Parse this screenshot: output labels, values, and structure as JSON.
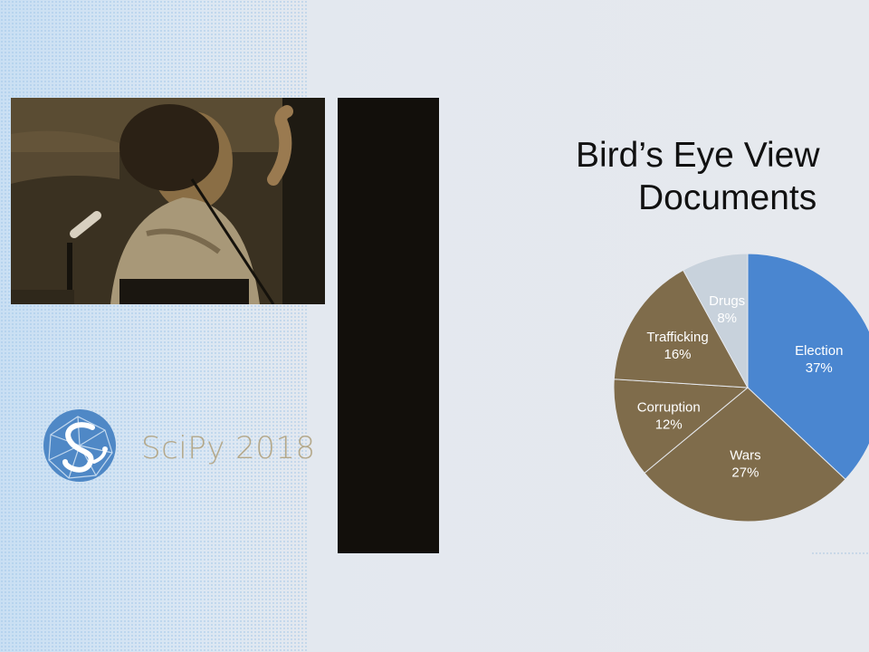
{
  "slide": {
    "title_line1": "Bird’s Eye View",
    "title_line2": "Documents"
  },
  "logo": {
    "text": "SciPy 2018"
  },
  "chart_data": {
    "type": "pie",
    "slices": [
      {
        "label": "Election",
        "value": 37,
        "text": "37%",
        "color": "#4a86d0"
      },
      {
        "label": "Wars",
        "value": 27,
        "text": "27%",
        "color": "#7f6c4b"
      },
      {
        "label": "Corruption",
        "value": 12,
        "text": "12%",
        "color": "#7f6c4b"
      },
      {
        "label": "Trafficking",
        "value": 16,
        "text": "16%",
        "color": "#7f6c4b"
      },
      {
        "label": "Drugs",
        "value": 8,
        "text": "8%",
        "color": "#c8d2dc"
      }
    ]
  },
  "colors": {
    "background": "#e6e9ee",
    "election": "#4a86d0",
    "other_slices": "#7f6c4b",
    "drugs": "#c8d2dc",
    "logo_blue": "#5b8fc8",
    "logo_text": "#b4a88a"
  }
}
